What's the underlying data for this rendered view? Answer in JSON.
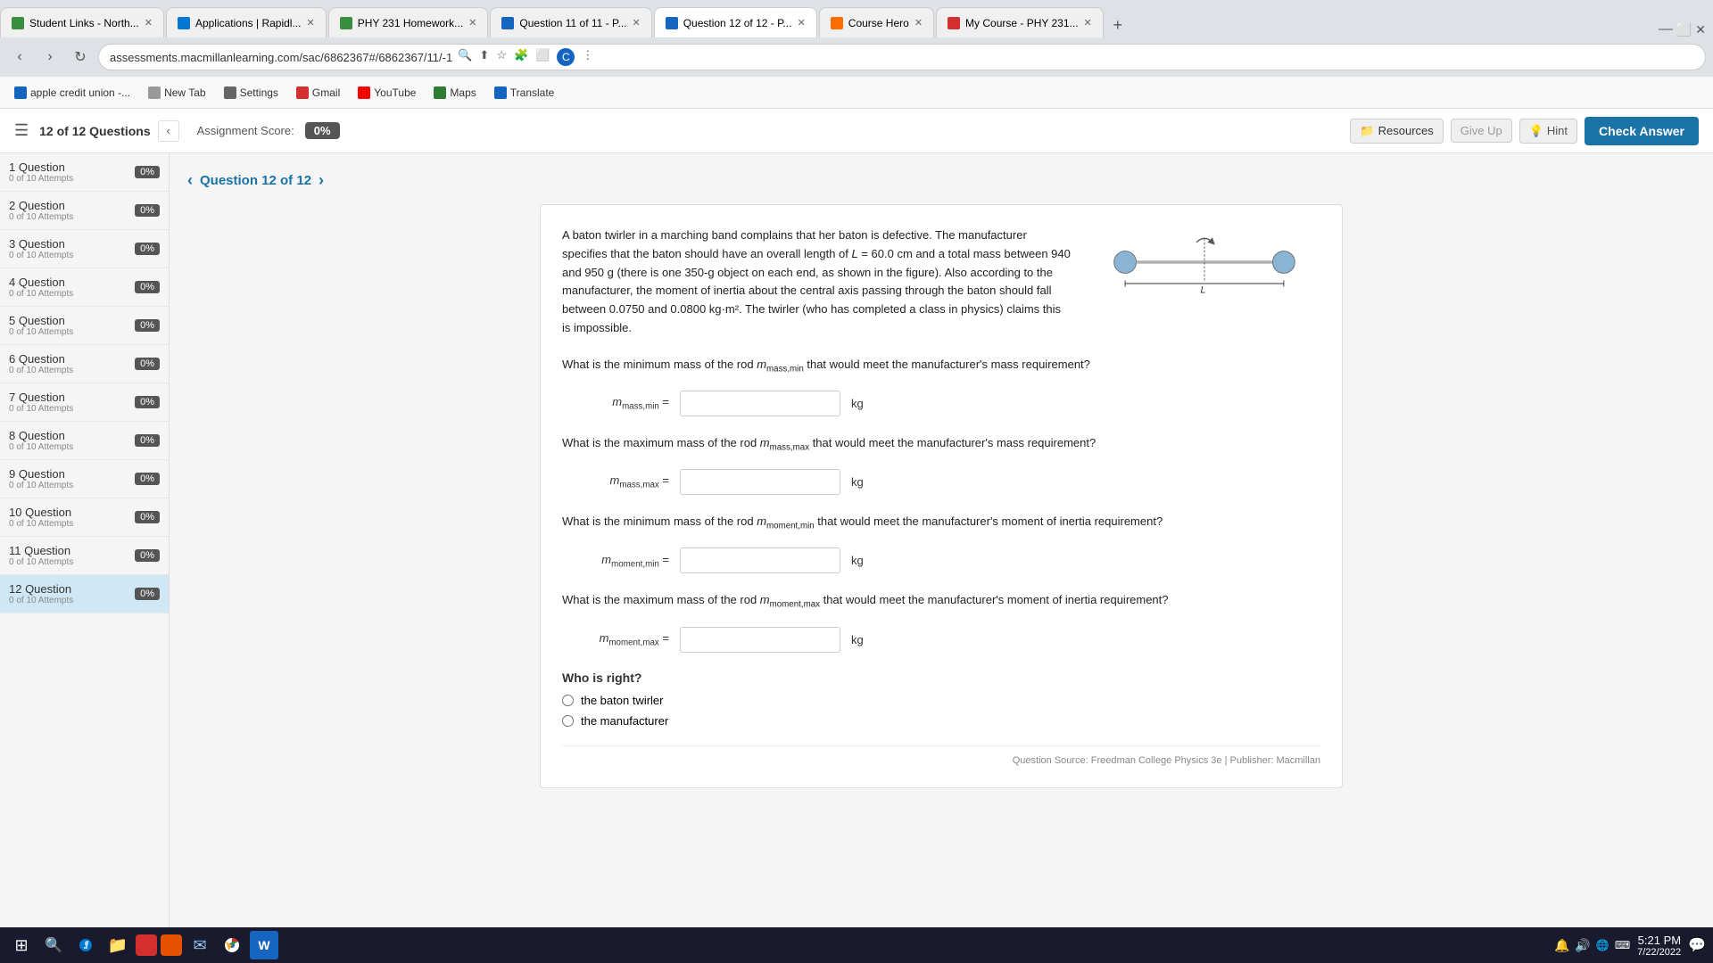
{
  "browser": {
    "tabs": [
      {
        "id": "t1",
        "label": "Student Links - North...",
        "favicon_color": "#388e3c",
        "active": false
      },
      {
        "id": "t2",
        "label": "Applications | Rapidl...",
        "favicon_color": "#0078d4",
        "active": false
      },
      {
        "id": "t3",
        "label": "PHY 231 Homework...",
        "favicon_color": "#388e3c",
        "active": false
      },
      {
        "id": "t4",
        "label": "Question 11 of 11 - P...",
        "favicon_color": "#1565c0",
        "active": false
      },
      {
        "id": "t5",
        "label": "Question 12 of 12 - P...",
        "favicon_color": "#1565c0",
        "active": true
      },
      {
        "id": "t6",
        "label": "Course Hero",
        "favicon_color": "#ff6d00",
        "active": false
      },
      {
        "id": "t7",
        "label": "My Course - PHY 231...",
        "favicon_color": "#d32f2f",
        "active": false
      }
    ],
    "url": "assessments.macmillanlearning.com/sac/6862367#/6862367/11/-1",
    "bookmarks": [
      {
        "label": "apple credit union -...",
        "favicon_color": "#1565c0"
      },
      {
        "label": "New Tab",
        "favicon_color": "#999"
      },
      {
        "label": "Settings",
        "favicon_color": "#666"
      },
      {
        "label": "Gmail",
        "favicon_color": "#d32f2f"
      },
      {
        "label": "YouTube",
        "favicon_color": "#ff0000"
      },
      {
        "label": "Maps",
        "favicon_color": "#2e7d32"
      },
      {
        "label": "Translate",
        "favicon_color": "#1565c0"
      }
    ]
  },
  "app_header": {
    "question_count": "12 of 12 Questions",
    "assignment_score_label": "Assignment Score:",
    "score": "0%",
    "resources_label": "Resources",
    "give_up_label": "Give Up",
    "hint_label": "Hint",
    "check_answer_label": "Check Answer"
  },
  "sidebar": {
    "items": [
      {
        "number": 1,
        "label": "1 Question",
        "attempts": "0 of 10 Attempts",
        "score": "0%"
      },
      {
        "number": 2,
        "label": "2 Question",
        "attempts": "0 of 10 Attempts",
        "score": "0%"
      },
      {
        "number": 3,
        "label": "3 Question",
        "attempts": "0 of 10 Attempts",
        "score": "0%"
      },
      {
        "number": 4,
        "label": "4 Question",
        "attempts": "0 of 10 Attempts",
        "score": "0%"
      },
      {
        "number": 5,
        "label": "5 Question",
        "attempts": "0 of 10 Attempts",
        "score": "0%"
      },
      {
        "number": 6,
        "label": "6 Question",
        "attempts": "0 of 10 Attempts",
        "score": "0%"
      },
      {
        "number": 7,
        "label": "7 Question",
        "attempts": "0 of 10 Attempts",
        "score": "0%"
      },
      {
        "number": 8,
        "label": "8 Question",
        "attempts": "0 of 10 Attempts",
        "score": "0%"
      },
      {
        "number": 9,
        "label": "9 Question",
        "attempts": "0 of 10 Attempts",
        "score": "0%"
      },
      {
        "number": 10,
        "label": "10 Question",
        "attempts": "0 of 10 Attempts",
        "score": "0%"
      },
      {
        "number": 11,
        "label": "11 Question",
        "attempts": "0 of 10 Attempts",
        "score": "0%"
      },
      {
        "number": 12,
        "label": "12 Question",
        "attempts": "0 of 10 Attempts",
        "score": "0%",
        "active": true
      }
    ]
  },
  "question_nav": {
    "title": "Question 12 of 12"
  },
  "question": {
    "body": "A baton twirler in a marching band complains that her baton is defective. The manufacturer specifies that the baton should have an overall length of L = 60.0 cm and a total mass between 940 and 950 g (there is one 350-g object on each end, as shown in the figure). Also according to the manufacturer, the moment of inertia about the central axis passing through the baton should fall between 0.0750 and 0.0800 kg·m². The twirler (who has completed a class in physics) claims this is impossible.",
    "sub_q1": "What is the minimum mass of the rod m_mass,min that would meet the manufacturer's mass requirement?",
    "sub_q1_label": "m_mass,min =",
    "sub_q1_unit": "kg",
    "sub_q2": "What is the maximum mass of the rod m_mass,max that would meet the manufacturer's mass requirement?",
    "sub_q2_label": "m_mass,max =",
    "sub_q2_unit": "kg",
    "sub_q3": "What is the minimum mass of the rod m_moment,min that would meet the manufacturer's moment of inertia requirement?",
    "sub_q3_label": "m_moment,min =",
    "sub_q3_unit": "kg",
    "sub_q4": "What is the maximum mass of the rod m_moment,max that would meet the manufacturer's moment of inertia requirement?",
    "sub_q4_label": "m_moment,max =",
    "sub_q4_unit": "kg",
    "who_is_right_label": "Who is right?",
    "option1": "the baton twirler",
    "option2": "the manufacturer",
    "footer": "Question Source: Freedman College Physics 3e  |  Publisher: Macmillan"
  },
  "taskbar": {
    "time": "5:21 PM",
    "date": "7/22/2022"
  }
}
